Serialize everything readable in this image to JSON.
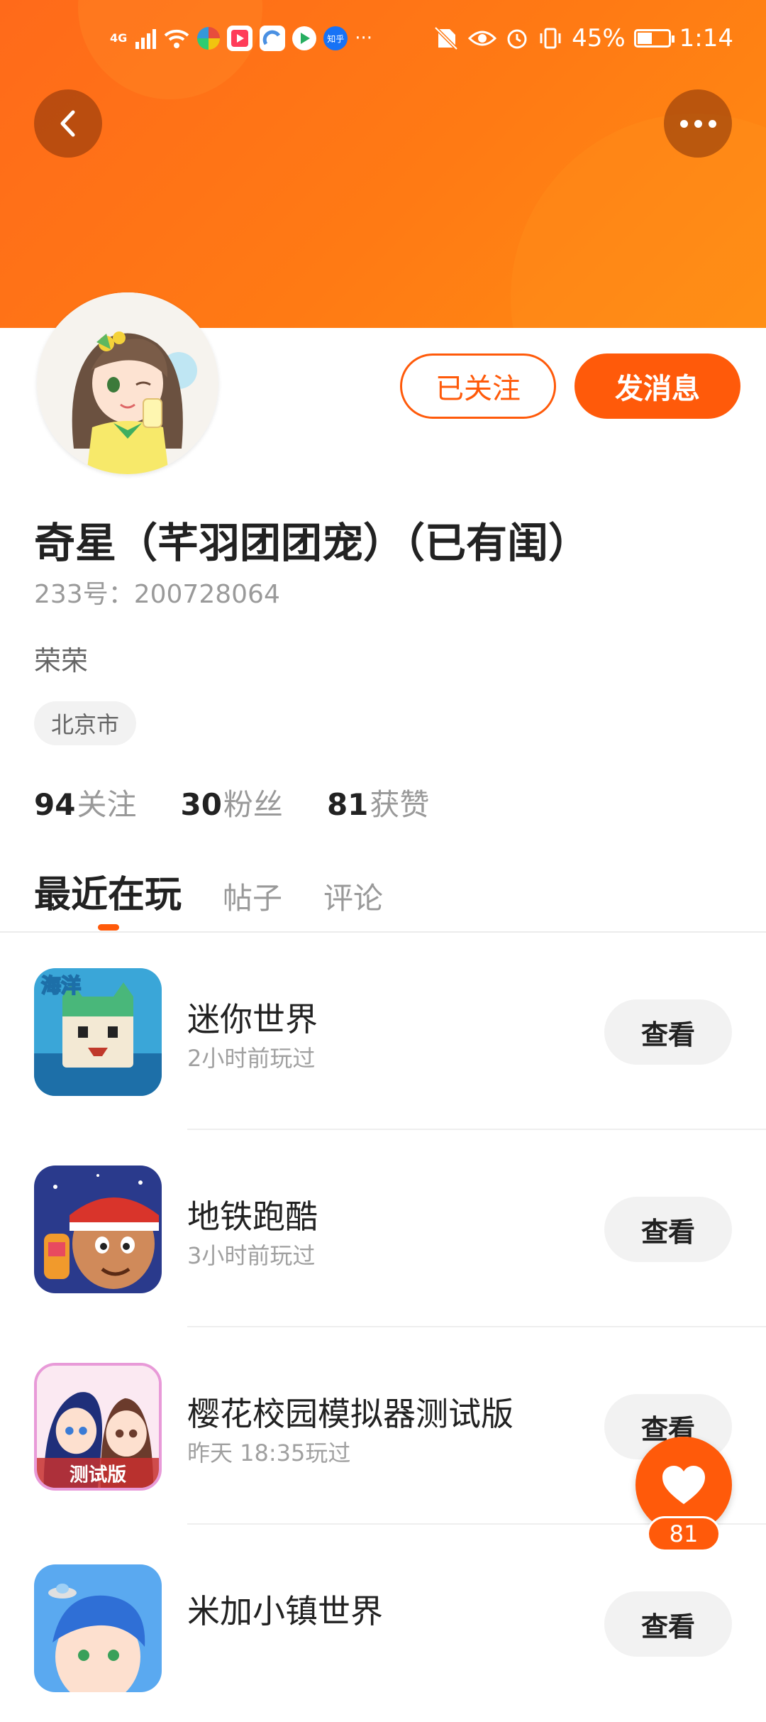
{
  "status_bar": {
    "network": "4G",
    "battery": "45%",
    "time": "1:14",
    "more": "···",
    "zhihu_label": "知乎"
  },
  "profile": {
    "name": "奇星（芊羽团团宠）（已有闺）",
    "uid": "233号：200728064",
    "bio": "荣荣",
    "location": "北京市",
    "follow_button": "已关注",
    "message_button": "发消息"
  },
  "stats": [
    {
      "count": "94",
      "label": "关注"
    },
    {
      "count": "30",
      "label": "粉丝"
    },
    {
      "count": "81",
      "label": "获赞"
    }
  ],
  "tabs": [
    {
      "label": "最近在玩",
      "active": true
    },
    {
      "label": "帖子",
      "active": false
    },
    {
      "label": "评论",
      "active": false
    }
  ],
  "games": [
    {
      "title": "迷你世界",
      "subtitle": "2小时前玩过",
      "button": "查看",
      "icon_text": "海洋"
    },
    {
      "title": "地铁跑酷",
      "subtitle": "3小时前玩过",
      "button": "查看"
    },
    {
      "title": "樱花校园模拟器测试版",
      "subtitle": "昨天 18:35玩过",
      "button": "查看",
      "icon_text": "测试版"
    },
    {
      "title": "米加小镇世界",
      "subtitle": "",
      "button": "查看"
    }
  ],
  "like_fab": {
    "count": "81",
    "icon": "heart-icon"
  },
  "colors": {
    "accent": "#ff5a0a",
    "header": "#ff7a14"
  }
}
